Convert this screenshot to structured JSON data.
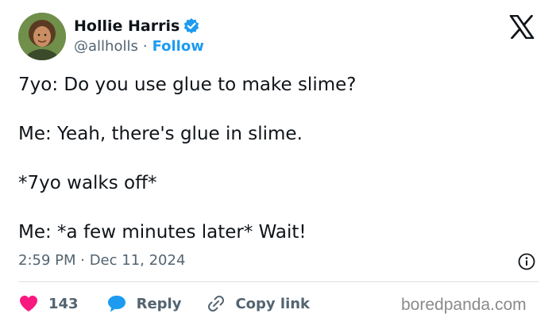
{
  "author": {
    "display_name": "Hollie Harris",
    "handle": "@allholls",
    "separator": "·",
    "follow_label": "Follow"
  },
  "tweet": {
    "lines": [
      "7yo: Do you use glue to make slime?",
      "Me: Yeah, there's glue in slime.",
      "*7yo walks off*",
      "Me: *a few minutes later* Wait!"
    ],
    "timestamp": "2:59 PM · Dec 11, 2024"
  },
  "actions": {
    "like_count": "143",
    "reply_label": "Reply",
    "copy_link_label": "Copy link"
  },
  "watermark": "boredpanda.com",
  "colors": {
    "accent": "#1d9bf0",
    "like": "#f91880",
    "text": "#0f1419",
    "muted": "#536471"
  }
}
